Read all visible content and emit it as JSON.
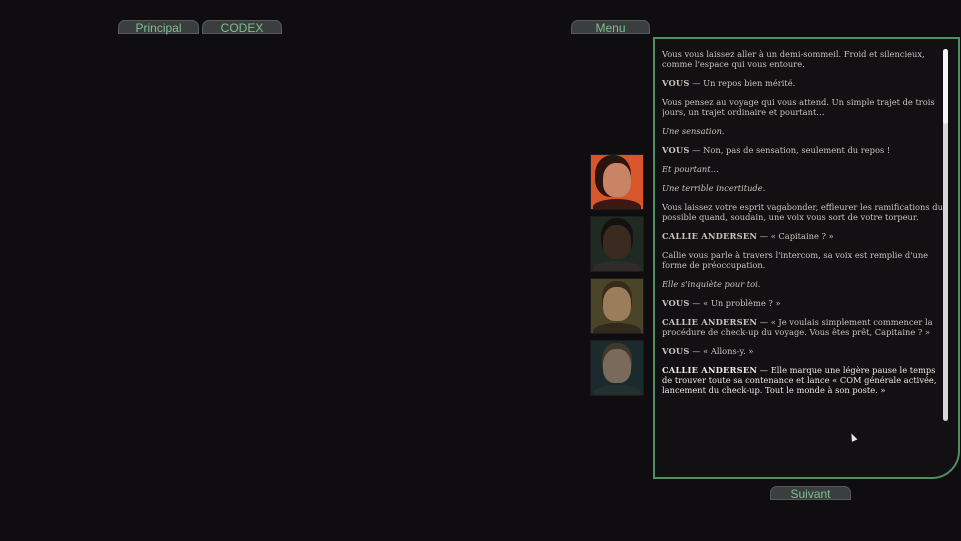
{
  "tabs": {
    "principal": "Principal",
    "codex": "CODEX",
    "menu": "Menu"
  },
  "dialogue": [
    {
      "type": "narration",
      "text": "Vous vous laissez aller à un demi-sommeil. Froid et silencieux, comme l'espace qui vous entoure."
    },
    {
      "type": "line",
      "speaker": "VOUS",
      "text": " — Un repos bien mérité."
    },
    {
      "type": "narration",
      "text": "Vous pensez au voyage qui vous attend. Un simple trajet de trois jours, un trajet ordinaire et pourtant…"
    },
    {
      "type": "italic",
      "text": "Une sensation."
    },
    {
      "type": "line",
      "speaker": "VOUS",
      "text": " — Non, pas de sensation, seulement du repos !"
    },
    {
      "type": "italic",
      "text": "Et pourtant…"
    },
    {
      "type": "italic",
      "text": "Une terrible incertitude."
    },
    {
      "type": "narration",
      "text": "Vous laissez votre esprit vagabonder, effleurer les ramifications du possible quand, soudain, une voix vous sort de votre torpeur."
    },
    {
      "type": "line",
      "speaker": "CALLIE ANDERSEN",
      "text": " — « Capitaine ? »"
    },
    {
      "type": "narration",
      "text": "Callie vous parle à travers l'intercom, sa voix est remplie d'une forme de préoccupation."
    },
    {
      "type": "italic",
      "text": "Elle s'inquiète pour toi."
    },
    {
      "type": "line",
      "speaker": "VOUS",
      "text": " — « Un problème ? »"
    },
    {
      "type": "line",
      "speaker": "CALLIE ANDERSEN",
      "text": " — « Je voulais simplement commencer la procédure de check-up du voyage. Vous êtes prêt, Capitaine ? »"
    },
    {
      "type": "line",
      "speaker": "VOUS",
      "text": " — « Allons-y. »"
    },
    {
      "type": "line",
      "speaker": "CALLIE ANDERSEN",
      "text": " — Elle marque une légère pause le temps de trouver toute sa contenance et lance « COM générale activée, lancement du check-up. Tout le monde à son poste. »"
    }
  ],
  "next_button": "Suivant",
  "colors": {
    "background": "#0f0d0f",
    "accent_green": "#4f8f62",
    "tab_text": "#7fbf8c"
  }
}
